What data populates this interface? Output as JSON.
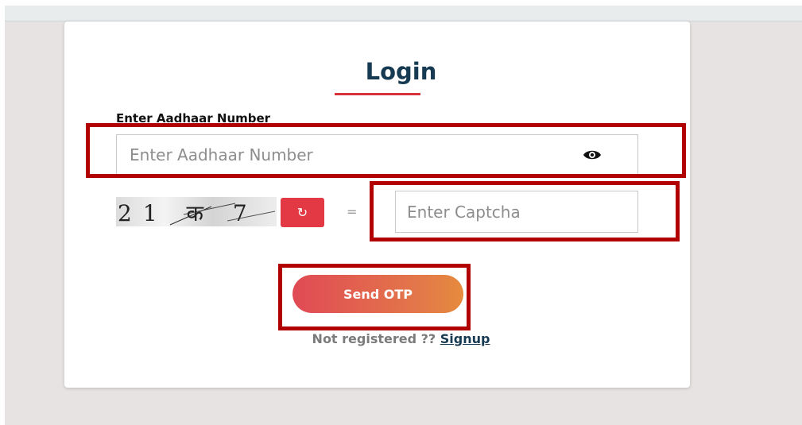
{
  "login": {
    "title": "Login",
    "aadhaar_label": "Enter Aadhaar Number",
    "aadhaar_placeholder": "Enter Aadhaar Number",
    "captcha_text": "21 क 7",
    "refresh_symbol": "↻",
    "equals": "=",
    "captcha_placeholder": "Enter Captcha",
    "send_otp_label": "Send OTP",
    "not_registered_text": "Not registered ?? ",
    "signup_link": "Signup"
  },
  "colors": {
    "title": "#163a52",
    "accent_red": "#d8323c",
    "button_gradient_start": "#e04a55",
    "button_gradient_end": "#e68b3e",
    "highlight_box": "#b00000"
  },
  "icons": {
    "password_toggle": "eye-icon",
    "captcha_refresh": "refresh-icon"
  }
}
